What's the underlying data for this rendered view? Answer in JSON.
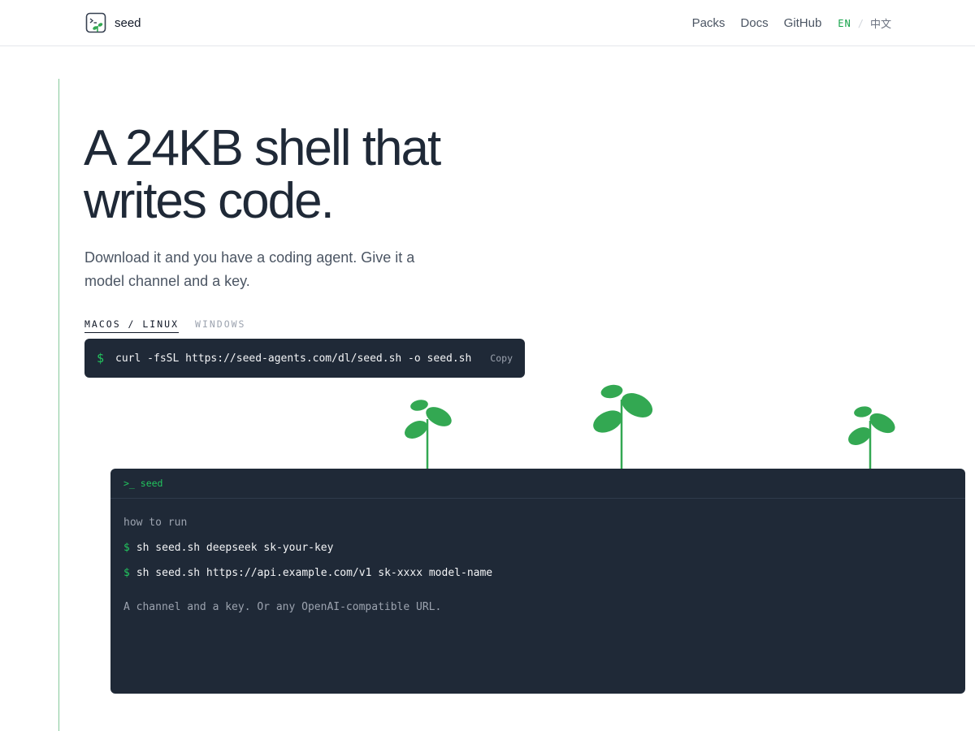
{
  "header": {
    "brand": "seed",
    "nav": [
      "Packs",
      "Docs",
      "GitHub"
    ],
    "lang_en": "EN",
    "lang_sep": "/",
    "lang_zh": "中文"
  },
  "hero": {
    "title_line1": "A 24KB shell that",
    "title_line2": "writes code.",
    "subtitle": "Download it and you have a coding agent. Give it a model channel and a key."
  },
  "install": {
    "tabs": [
      "MACOS / LINUX",
      "WINDOWS"
    ],
    "prompt": "$",
    "command": "curl -fsSL https://seed-agents.com/dl/seed.sh -o seed.sh",
    "copy_label": "Copy"
  },
  "terminal": {
    "title": ">_ seed",
    "label": "how to run",
    "prompt": "$",
    "lines": [
      "sh seed.sh deepseek sk-your-key",
      "sh seed.sh https://api.example.com/v1 sk-xxxx model-name"
    ],
    "note": "A channel and a key. Or any OpenAI-compatible URL."
  },
  "colors": {
    "accent": "#22c55e",
    "leaf": "#33a852",
    "dark": "#1f2937",
    "rail": "#86c99b"
  },
  "icons": {
    "brand_logo": "terminal-sprout-icon"
  }
}
